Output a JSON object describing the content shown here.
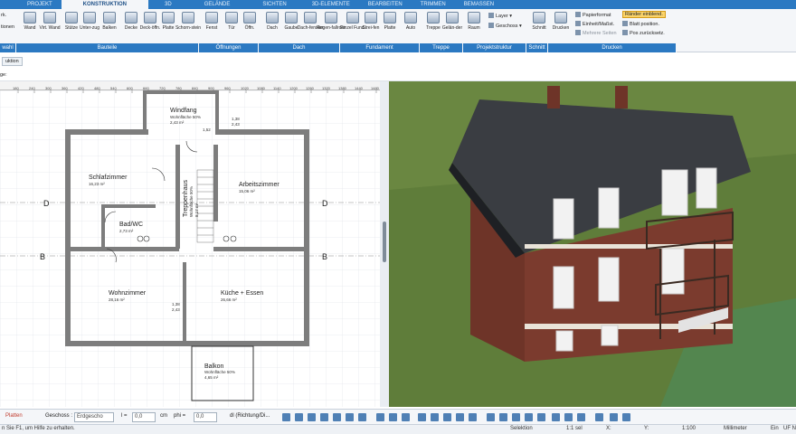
{
  "tabs": [
    "PROJEKT",
    "KONSTRUKTION",
    "3D",
    "GELÄNDE",
    "SICHTEN",
    "3D-ELEMENTE",
    "BEARBEITEN",
    "TRIMMEN",
    "BEMASSEN"
  ],
  "ribbon": {
    "left": [
      "rk.",
      "tionen"
    ],
    "buttons": [
      "Wand",
      "Virt. Wand",
      "Stütze",
      "Unter-zug",
      "Balken",
      "Decke",
      "Deck-öffn.",
      "Platte",
      "Schorn-stein",
      "Fenst",
      "Tür",
      "Öffn.",
      "Dach",
      "Gaube",
      "Dach-fenster",
      "Regen-fallrohr",
      "Einzel Fund.",
      "Strei-fen",
      "Platte",
      "Auto",
      "Treppe",
      "Gelän-der",
      "Raum",
      "Schnitt",
      "Drucken"
    ],
    "groups": [
      "wahl",
      "Bauteile",
      "Öffnungen",
      "Dach",
      "Fundament",
      "Treppe",
      "Projektstruktur",
      "Schnitt",
      "Drucken"
    ],
    "small": {
      "layer": "Layer",
      "geschoss": "Geschoss",
      "papierformat": "Papierformat",
      "einheit": "Einheit/Maßst.",
      "mehrere": "Mehrere Seiten",
      "raender": "Ränder einblend.",
      "blatt": "Blatt position.",
      "pos": "Pos zurücksetz."
    }
  },
  "strip": {
    "tab": "uktion",
    "label": "ge:"
  },
  "plan": {
    "rulerticks": [
      "180",
      "240",
      "300",
      "360",
      "420",
      "480",
      "540",
      "600",
      "660",
      "720",
      "780",
      "840",
      "900",
      "960",
      "1020",
      "1080",
      "1140",
      "1200",
      "1260",
      "1320",
      "1380",
      "1440",
      "1480"
    ],
    "axes": [
      "D",
      "D",
      "B",
      "B"
    ],
    "rooms": [
      {
        "name": "Windfang",
        "sub": "Wohnfläche 50%",
        "area": "2,43 m²"
      },
      {
        "name": "Schlafzimmer",
        "area": "16,23 m²"
      },
      {
        "name": "Arbeitszimmer",
        "area": "15,06 m²"
      },
      {
        "name": "Bad/WC",
        "area": "2,73 m²"
      },
      {
        "name": "Wohnzimmer",
        "area": "28,16 m²"
      },
      {
        "name": "Küche + Essen",
        "area": "26,66 m²"
      },
      {
        "name": "Balkon",
        "sub": "Wohnfläche 50%",
        "area": "4,65 m²"
      },
      {
        "name": "Treppenhaus",
        "sub": "Wohnfläche 50%",
        "area": "8,17 m²"
      }
    ],
    "dims": [
      "1,52",
      "1,38",
      "2,43",
      "1,38",
      "2,43"
    ]
  },
  "bottom": {
    "platten": "Platten",
    "geschoss_label": "Geschoss :",
    "geschoss_value": "Erdgescho",
    "l_label": "l =",
    "l_value": "0,0",
    "cm": "cm",
    "phi_label": "phi =",
    "phi_value": "0,0",
    "richtung": "dl (Richtung/Di..."
  },
  "status": {
    "hint": "n Sie F1, um Hilfe zu erhalten.",
    "selektion": "Selektion",
    "ratio": "1:1 sel",
    "x": "X:",
    "y": "Y:",
    "scale": "1:100",
    "unit": "Millimeter",
    "ein": "Ein",
    "uf": "UF N"
  },
  "colors": {
    "accent": "#2b79c2",
    "brick": "#7b3b2e",
    "roof": "#3a3d42",
    "grass": "#5f7d3a"
  }
}
